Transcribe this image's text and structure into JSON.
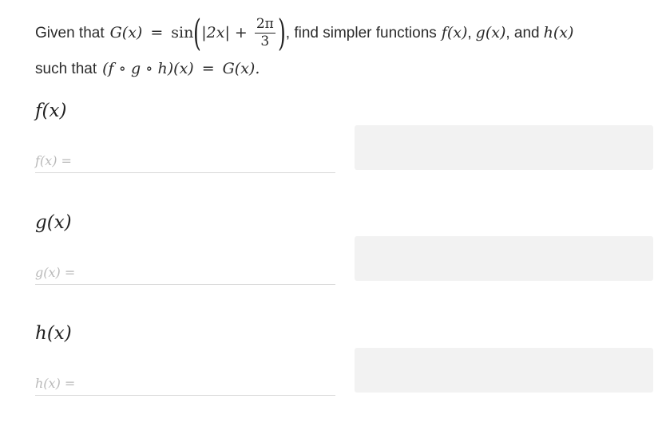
{
  "question": {
    "given_that": "Given that",
    "G_of_x": "G(x)",
    "equals": "=",
    "sin": "sin",
    "abs_2x": "|2x|",
    "plus": "+",
    "frac_num": "2π",
    "frac_den": "3",
    "find_text": ", find simpler functions",
    "f_of_x": "f(x)",
    "comma1": ",",
    "g_of_x": "g(x)",
    "comma_and": ", and",
    "h_of_x": "h(x)",
    "such_that": "such that",
    "composition": "(f ∘ g ∘ h)(x)",
    "equals2": "=",
    "G_of_x_end": "G(x)."
  },
  "parts": [
    {
      "label": "f(x)",
      "placeholder": "f(x) ="
    },
    {
      "label": "g(x)",
      "placeholder": "g(x) ="
    },
    {
      "label": "h(x)",
      "placeholder": "h(x) ="
    }
  ]
}
